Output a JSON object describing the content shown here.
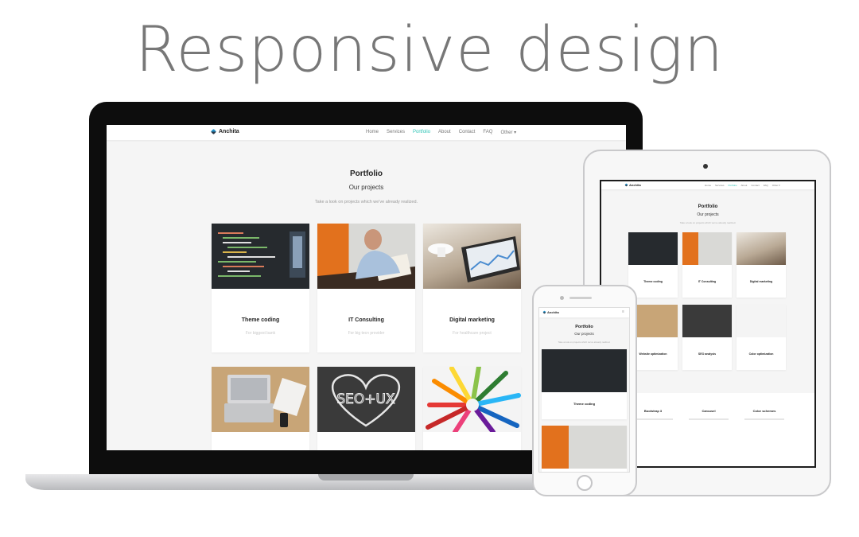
{
  "headline": "Responsive design",
  "site": {
    "brand": "Anchita",
    "nav": [
      "Home",
      "Services",
      "Portfolio",
      "About",
      "Contact",
      "FAQ",
      "Other ▾"
    ],
    "active_nav": "Portfolio",
    "title": "Portfolio",
    "subtitle": "Our projects",
    "tagline": "Take a look on projects which we've already realized.",
    "projects": [
      {
        "title": "Theme coding",
        "client": "For biggest bank",
        "image": "code-screen"
      },
      {
        "title": "IT Consulting",
        "client": "For big tecn provider",
        "image": "consultant-desk"
      },
      {
        "title": "Digital marketing",
        "client": "For healthcare project",
        "image": "tablet-charts"
      },
      {
        "title": "Website optimization",
        "client": "",
        "image": "laptop-workspace"
      },
      {
        "title": "SEO analysis",
        "client": "",
        "image": "seo-ux-chalkboard"
      },
      {
        "title": "Color optimization",
        "client": "",
        "image": "colored-pencils"
      }
    ],
    "features": [
      {
        "title": "Bootstrap 3"
      },
      {
        "title": "Carousel"
      },
      {
        "title": "Color schemes"
      }
    ]
  },
  "colors": {
    "accent": "#2ec4b6",
    "headline": "#777777",
    "page_bg": "#f5f5f5"
  }
}
